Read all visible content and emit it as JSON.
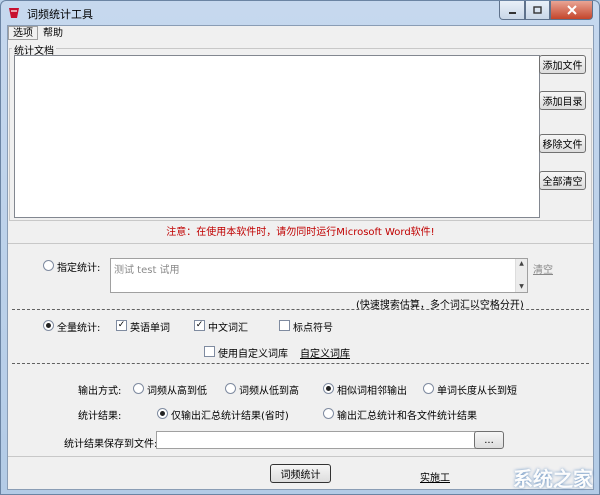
{
  "window": {
    "title": "词频统计工具"
  },
  "menu": [
    "选项",
    "帮助"
  ],
  "documents": {
    "group_label": "统计文档",
    "buttons": {
      "add_file": "添加文件",
      "add_dir": "添加目录",
      "remove_file": "移除文件",
      "clear_all": "全部清空"
    }
  },
  "notice": "注意：在使用本软件时，请勿同时运行Microsoft Word软件!",
  "specified": {
    "label": "指定统计:",
    "text": "测试 test 试用",
    "clear_link": "清空",
    "hint": "(快速搜索估算，多个词汇以空格分开)"
  },
  "full": {
    "label": "全量统计:",
    "english": "英语单词",
    "chinese": "中文词汇",
    "punct": "标点符号",
    "custom_lib": "使用自定义词库",
    "custom_lib_link": "自定义词库"
  },
  "output": {
    "mode_label": "输出方式:",
    "modes": [
      "词频从高到低",
      "词频从低到高",
      "相似词相邻输出",
      "单词长度从长到短"
    ],
    "result_label": "统计结果:",
    "results": [
      "仅输出汇总统计结果(省时)",
      "输出汇总统计和各文件统计结果"
    ],
    "save_label": "统计结果保存到文件:",
    "save_value": "",
    "browse": "..."
  },
  "actions": {
    "run": "词频统计"
  },
  "footer_link": "实施工",
  "watermark": "系统之家"
}
